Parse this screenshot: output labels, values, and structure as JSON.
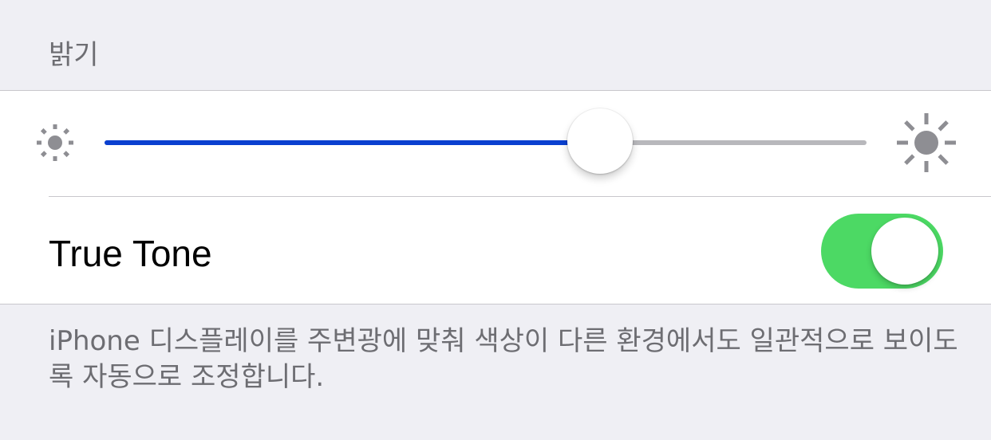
{
  "brightness": {
    "header": "밝기",
    "level": 0.65,
    "min_icon": "sun-small-icon",
    "max_icon": "sun-large-icon",
    "fill_color": "#0a40d0"
  },
  "true_tone": {
    "label": "True Tone",
    "enabled": true,
    "on_color": "#4cd964"
  },
  "footer": {
    "text": "iPhone 디스플레이를 주변광에 맞춰 색상이 다른 환경에서도 일관적으로 보이도록 자동으로 조정합니다."
  }
}
